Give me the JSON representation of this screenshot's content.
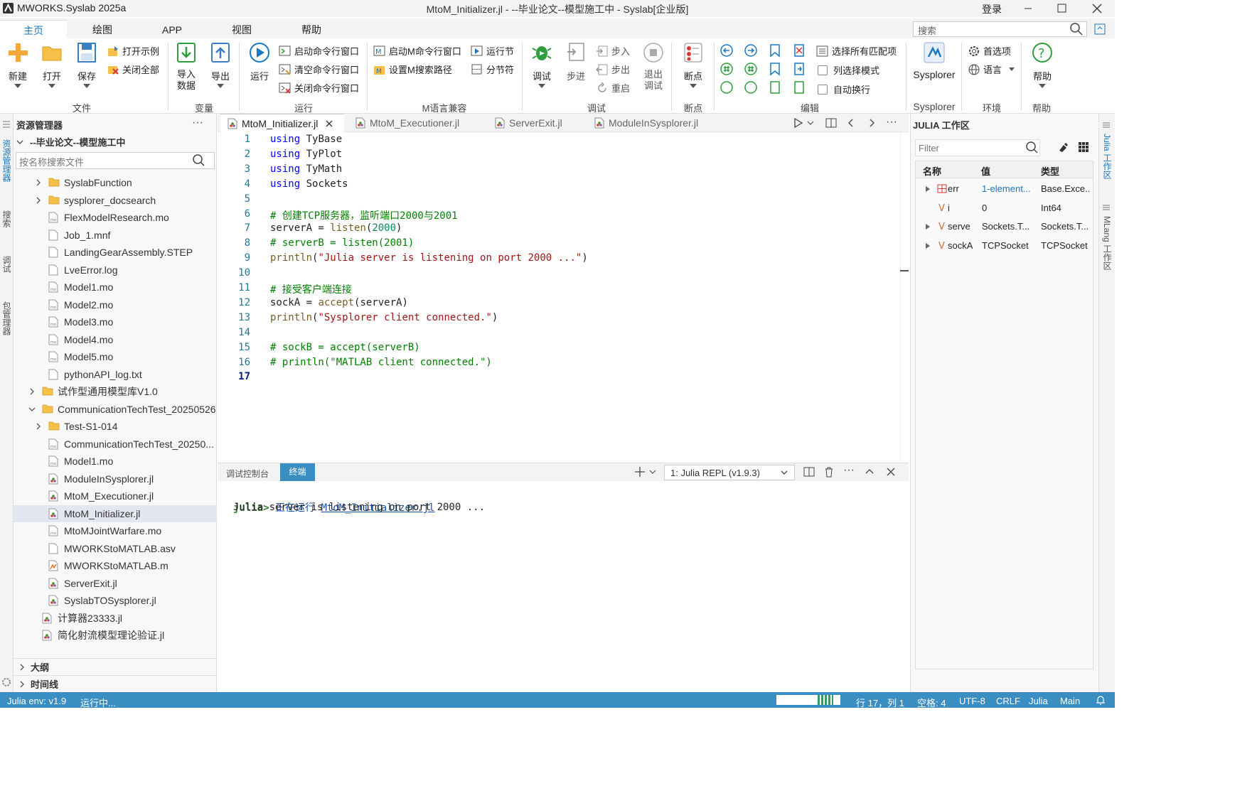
{
  "app": {
    "name": "MWORKS.Syslab 2025a",
    "window_title": "MtoM_Initializer.jl - --毕业论文--模型施工中 - Syslab[企业版]",
    "login": "登录"
  },
  "menu": {
    "tabs": [
      "主页",
      "绘图",
      "APP",
      "视图",
      "帮助"
    ],
    "search_placeholder": "搜索"
  },
  "ribbon": {
    "file": {
      "new": "新建",
      "open": "打开",
      "save": "保存",
      "open_example": "打开示例",
      "close_all": "关闭全部",
      "group": "文件"
    },
    "variable": {
      "import_line1": "导入",
      "import_line2": "数据",
      "export": "导出",
      "group": "变量"
    },
    "run": {
      "run": "运行",
      "start_cmd": "启动命令行窗口",
      "clear_cmd": "清空命令行窗口",
      "close_cmd": "关闭命令行窗口",
      "group": "运行"
    },
    "mlang": {
      "start_m": "启动M命令行窗口",
      "set_m_path": "设置M搜索路径",
      "run_section": "运行节",
      "section_break": "分节符",
      "group": "M语言兼容"
    },
    "debug": {
      "debug": "调试",
      "step": "步进",
      "step_in": "步入",
      "step_out": "步出",
      "restart": "重启",
      "exit_line1": "退出",
      "exit_line2": "调试",
      "group": "调试"
    },
    "breakpoint": {
      "label": "断点",
      "group": "断点"
    },
    "edit": {
      "select_all_matches": "选择所有匹配项",
      "column_select": "列选择模式",
      "auto_wrap": "自动换行",
      "group": "编辑"
    },
    "sysplorer": {
      "label": "Sysplorer",
      "group": "Sysplorer"
    },
    "env": {
      "prefs": "首选项",
      "lang": "语言",
      "group": "环境"
    },
    "help": {
      "label": "帮助",
      "group": "帮助"
    }
  },
  "sidebar": {
    "activity": [
      "资源管理器",
      "搜索",
      "调试",
      "包管理器"
    ]
  },
  "explorer": {
    "title": "资源管理器",
    "root": "--毕业论文--模型施工中",
    "search_placeholder": "按名称搜索文件",
    "items": [
      {
        "label": "SyslabFunction",
        "type": "folder",
        "indent": 2,
        "chev": "right"
      },
      {
        "label": "sysplorer_docsearch",
        "type": "folder",
        "indent": 2,
        "chev": "right"
      },
      {
        "label": "FlexModelResearch.mo",
        "type": "mo",
        "indent": 2
      },
      {
        "label": "Job_1.mnf",
        "type": "file",
        "indent": 2
      },
      {
        "label": "LandingGearAssembly.STEP",
        "type": "file",
        "indent": 2
      },
      {
        "label": "LveError.log",
        "type": "file",
        "indent": 2
      },
      {
        "label": "Model1.mo",
        "type": "mo",
        "indent": 2
      },
      {
        "label": "Model2.mo",
        "type": "mo",
        "indent": 2
      },
      {
        "label": "Model3.mo",
        "type": "mo",
        "indent": 2
      },
      {
        "label": "Model4.mo",
        "type": "mo",
        "indent": 2
      },
      {
        "label": "Model5.mo",
        "type": "mo",
        "indent": 2
      },
      {
        "label": "pythonAPI_log.txt",
        "type": "file",
        "indent": 2
      },
      {
        "label": "试作型通用模型库V1.0",
        "type": "folder",
        "indent": 1,
        "chev": "right"
      },
      {
        "label": "CommunicationTechTest_20250526",
        "type": "folder",
        "indent": 1,
        "chev": "down"
      },
      {
        "label": "Test-S1-014",
        "type": "folder",
        "indent": 2,
        "chev": "right"
      },
      {
        "label": "CommunicationTechTest_20250...",
        "type": "mo",
        "indent": 2
      },
      {
        "label": "Model1.mo",
        "type": "mo",
        "indent": 2
      },
      {
        "label": "ModuleInSysplorer.jl",
        "type": "jl",
        "indent": 2
      },
      {
        "label": "MtoM_Executioner.jl",
        "type": "jl",
        "indent": 2
      },
      {
        "label": "MtoM_Initializer.jl",
        "type": "jl",
        "indent": 2,
        "selected": true
      },
      {
        "label": "MtoMJointWarfare.mo",
        "type": "mo",
        "indent": 2
      },
      {
        "label": "MWORKStoMATLAB.asv",
        "type": "file",
        "indent": 2
      },
      {
        "label": "MWORKStoMATLAB.m",
        "type": "m",
        "indent": 2
      },
      {
        "label": "ServerExit.jl",
        "type": "jl",
        "indent": 2
      },
      {
        "label": "SyslabTOSysplorer.jl",
        "type": "jl",
        "indent": 2
      },
      {
        "label": "计算器23333.jl",
        "type": "jl",
        "indent": 1
      },
      {
        "label": "简化射流模型理论验证.jl",
        "type": "jl",
        "indent": 1
      }
    ],
    "outline": "大纲",
    "timeline": "时间线"
  },
  "editor": {
    "tabs": [
      {
        "label": "MtoM_Initializer.jl",
        "active": true
      },
      {
        "label": "MtoM_Executioner.jl"
      },
      {
        "label": "ServerExit.jl"
      },
      {
        "label": "ModuleInSysplorer.jl"
      }
    ],
    "lines": [
      [
        [
          "kw",
          "using"
        ],
        [
          "t",
          " TyBase"
        ]
      ],
      [
        [
          "kw",
          "using"
        ],
        [
          "t",
          " TyPlot"
        ]
      ],
      [
        [
          "kw",
          "using"
        ],
        [
          "t",
          " TyMath"
        ]
      ],
      [
        [
          "kw",
          "using"
        ],
        [
          "t",
          " Sockets"
        ]
      ],
      [],
      [
        [
          "cm",
          "# 创建TCP服务器，监听端口2000与2001"
        ]
      ],
      [
        [
          "t",
          "serverA = "
        ],
        [
          "fn",
          "listen"
        ],
        [
          "t",
          "("
        ],
        [
          "nm",
          "2000"
        ],
        [
          "t",
          ")"
        ]
      ],
      [
        [
          "cm",
          "# serverB = listen(2001)"
        ]
      ],
      [
        [
          "fn",
          "println"
        ],
        [
          "t",
          "("
        ],
        [
          "st",
          "\"Julia server is listening on port 2000 ...\""
        ],
        [
          "t",
          ")"
        ]
      ],
      [],
      [
        [
          "cm",
          "# 接受客户端连接"
        ]
      ],
      [
        [
          "t",
          "sockA = "
        ],
        [
          "fn",
          "accept"
        ],
        [
          "t",
          "(serverA)"
        ]
      ],
      [
        [
          "fn",
          "println"
        ],
        [
          "t",
          "("
        ],
        [
          "st",
          "\"Sysplorer client connected.\""
        ],
        [
          "t",
          ")"
        ]
      ],
      [],
      [
        [
          "cm",
          "# sockB = accept(serverB)"
        ]
      ],
      [
        [
          "cm",
          "# println(\"MATLAB client connected.\")"
        ]
      ],
      []
    ],
    "current_line": 17
  },
  "panel": {
    "tabs": [
      "调试控制台",
      "终端"
    ],
    "repl_select": "1: Julia REPL (v1.9.3)",
    "prompt": "julia>",
    "running_label": "正在运行",
    "running_file": "MtoM_Initializer.jl",
    "output": "Julia server is listening on port 2000 ..."
  },
  "workspace": {
    "title": "JULIA 工作区",
    "filter_placeholder": "Filter",
    "columns": [
      "名称",
      "值",
      "类型"
    ],
    "rows": [
      {
        "name": "err",
        "value": "1-element...",
        "type": "Base.Exce...",
        "expand": true,
        "icon": "array"
      },
      {
        "name": "i",
        "value": "0",
        "type": "Int64",
        "expand": false,
        "icon": "var"
      },
      {
        "name": "serve",
        "value": "Sockets.T...",
        "type": "Sockets.T...",
        "expand": true,
        "icon": "var"
      },
      {
        "name": "sockA",
        "value": "TCPSocket",
        "type": "TCPSocket",
        "expand": true,
        "icon": "var"
      }
    ]
  },
  "rightbar": {
    "labels": [
      "Julia 工作区",
      "MLang 工作区"
    ]
  },
  "status": {
    "env": "Julia env: v1.9",
    "running": "运行中...",
    "pos": "行 17，列 1",
    "spaces": "空格: 4",
    "encoding": "UTF-8",
    "eol": "CRLF",
    "lang": "Julia",
    "branch": "Main"
  },
  "colors": {
    "accent": "#1a78c2",
    "status_bar": "#3b8ec2",
    "selected_row": "#e4e6f1",
    "keyword": "#0000ff",
    "comment": "#008000",
    "string": "#a31515"
  }
}
